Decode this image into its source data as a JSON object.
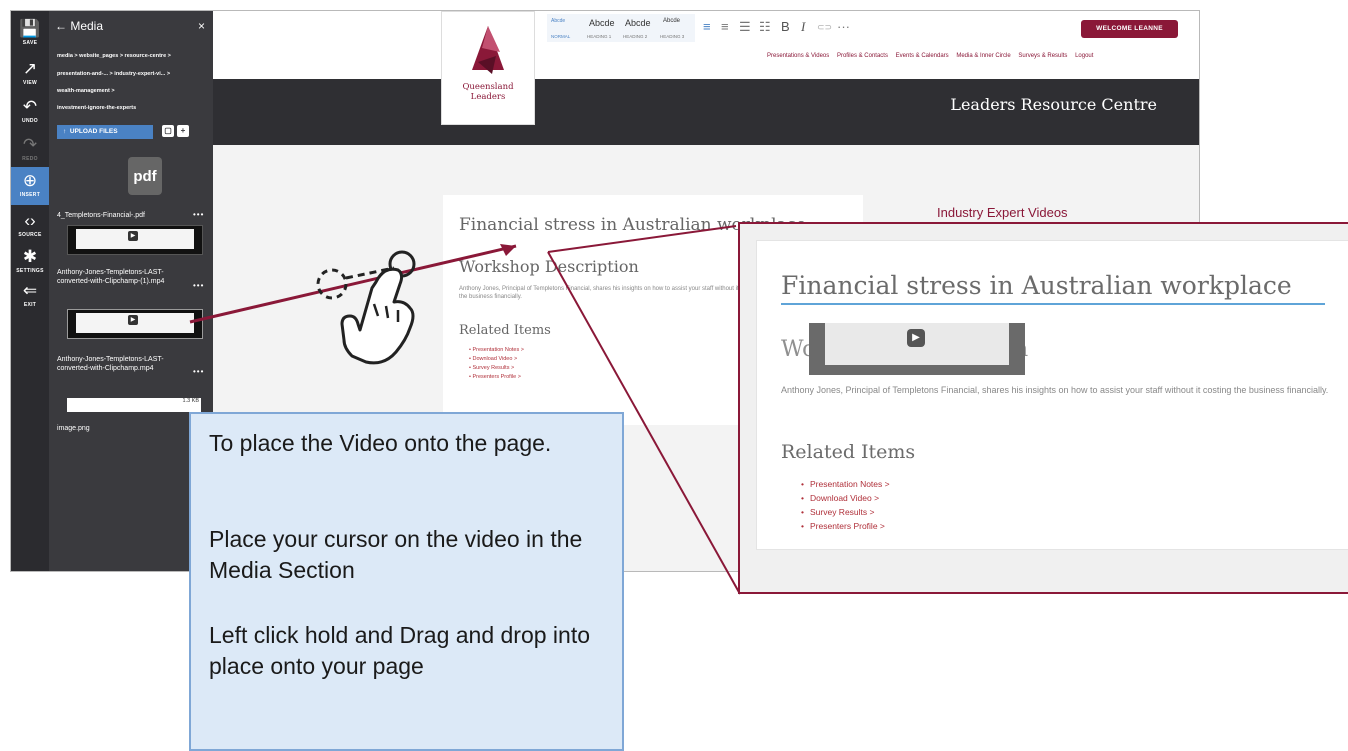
{
  "sidebar_tools": [
    {
      "label": "SAVE",
      "icon": "save-icon",
      "glyph": "💾"
    },
    {
      "label": "VIEW",
      "icon": "view-icon",
      "glyph": "↗"
    },
    {
      "label": "UNDO",
      "icon": "undo-icon",
      "glyph": "↶"
    },
    {
      "label": "REDO",
      "icon": "redo-icon",
      "glyph": "↷"
    },
    {
      "label": "INSERT",
      "icon": "insert-icon",
      "glyph": "⊕"
    },
    {
      "label": "SOURCE",
      "icon": "source-icon",
      "glyph": "‹›"
    },
    {
      "label": "SETTINGS",
      "icon": "settings-icon",
      "glyph": "✱"
    },
    {
      "label": "EXIT",
      "icon": "exit-icon",
      "glyph": "⇐"
    }
  ],
  "media_panel": {
    "title": "← Media",
    "close": "×",
    "breadcrumb": [
      "media > website_pages > resource-centre >",
      "presentation-and-... > industry-expert-vi... >",
      "wealth-management >",
      "investment-ignore-the-experts"
    ],
    "upload_label": "UPLOAD FILES",
    "upload_icon": "upload-icon",
    "files": [
      {
        "name": "4_Templetons-Financial-.pdf",
        "kind": "pdf",
        "thumb_text": "pdf"
      },
      {
        "name": "Anthony-Jones-Templetons-LAST-converted-with-Clipchamp-(1).mp4",
        "kind": "video"
      },
      {
        "name": "Anthony-Jones-Templetons-LAST-converted-with-Clipchamp.mp4",
        "kind": "video"
      },
      {
        "name": "image.png",
        "kind": "image",
        "size": "1.3 KB"
      }
    ],
    "more": "•••"
  },
  "site": {
    "logo_text": [
      "Queensland",
      "Leaders"
    ],
    "welcome": "WELCOME LEANNE",
    "nav": [
      "Presentations & Videos",
      "Profiles & Contacts",
      "Events & Calendars",
      "Media & Inner Circle",
      "Surveys & Results",
      "Logout"
    ],
    "banner_title": "Leaders Resource Centre",
    "format_styles": [
      {
        "sample": "Abcde",
        "name": "NORMAL"
      },
      {
        "sample": "Abcde",
        "name": "HEADING 1"
      },
      {
        "sample": "Abcde",
        "name": "HEADING 2"
      },
      {
        "sample": "Abcde",
        "name": "HEADING 3"
      }
    ],
    "format_buttons": [
      "≡",
      "≡",
      "☰",
      "☷",
      "B",
      "I",
      "⊂⊃",
      "···"
    ],
    "side_heading": "Industry Expert Videos"
  },
  "content": {
    "title": "Financial stress in Australian workplace",
    "workshop_heading": "Workshop Description",
    "description": "Anthony Jones, Principal of Templetons Financial, shares his insights on how to assist your staff without it costing the business financially.",
    "related_heading": "Related Items",
    "related_items": [
      "Presentation Notes >",
      "Download Video >",
      "Survey Results >",
      "Presenters Profile >"
    ]
  },
  "instructions": [
    "To place the Video onto the page.",
    "Place your cursor on the video in the Media Section",
    "Left click hold and Drag and drop into place onto your page"
  ],
  "colors": {
    "accent": "#8a1838",
    "highlight": "#4a82c4",
    "callout_bg": "#dce9f7"
  }
}
